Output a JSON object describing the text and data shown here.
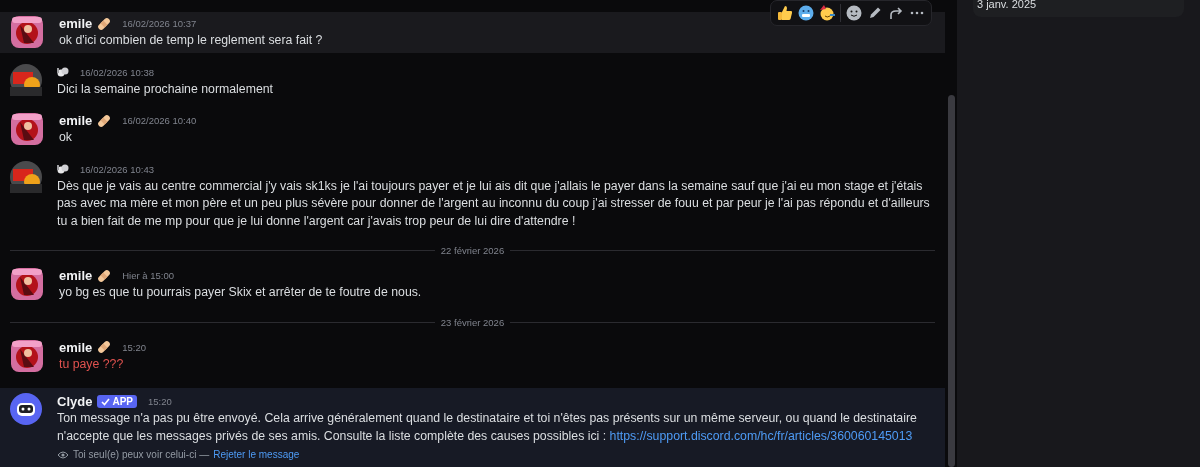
{
  "toolbar": {
    "reactions": [
      {
        "kind": "thumbs-up"
      },
      {
        "kind": "cold-face"
      },
      {
        "kind": "party-face"
      }
    ],
    "actions": [
      {
        "kind": "emoji"
      },
      {
        "kind": "edit"
      },
      {
        "kind": "forward"
      },
      {
        "kind": "more"
      }
    ]
  },
  "items": [
    {
      "kind": "message",
      "avatar": {
        "kind": "pink"
      },
      "name": "emile",
      "badge_emoji": true,
      "time": "16/02/2026 10:37",
      "text": "ok d'ici combien de temp le reglement sera fait ?",
      "hovered": true,
      "failed": false
    },
    {
      "kind": "message",
      "avatar": {
        "kind": "orange"
      },
      "time": "16/02/2026 10:38",
      "text": "Dici la semaine prochaine normalement",
      "failed": false
    },
    {
      "kind": "message",
      "avatar": {
        "kind": "pink"
      },
      "name": "emile",
      "badge_emoji": true,
      "time": "16/02/2026 10:40",
      "text": "ok",
      "failed": false
    },
    {
      "kind": "message",
      "avatar": {
        "kind": "orange"
      },
      "time": "16/02/2026 10:43",
      "text": "Dès que je vais au centre commercial j'y vais sk1ks je l'ai toujours payer et je lui ais dit que j'allais le payer dans la semaine sauf que j'ai eu mon stage et j'étais pas avec ma mère et mon père et un peu plus sévère pour donner de l'argent au inconnu du coup j'ai stresser de fouu et par peur je l'ai pas répondu et d'ailleurs tu a bien fait de me mp pour que je lui donne l'argent car j'avais trop peur de lui dire d'attendre !",
      "failed": false
    },
    {
      "kind": "divider",
      "label": "22 février 2026"
    },
    {
      "kind": "message",
      "avatar": {
        "kind": "pink"
      },
      "name": "emile",
      "badge_emoji": true,
      "time": "Hier à 15:00",
      "text": "yo bg es que tu pourrais payer Skix et arrêter de te foutre de nous.",
      "failed": false
    },
    {
      "kind": "divider",
      "label": "23 février 2026"
    },
    {
      "kind": "message",
      "avatar": {
        "kind": "pink"
      },
      "name": "emile",
      "badge_emoji": true,
      "time": "15:20",
      "text": "tu paye ???",
      "failed": true
    },
    {
      "kind": "system",
      "avatar": {
        "kind": "bot"
      },
      "name": "Clyde",
      "app_badge": "APP",
      "time": "15:20",
      "text": "Ton message n'a pas pu être envoyé. Cela arrive généralement quand le destinataire et toi n'êtes pas présents sur un même serveur, ou quand le destinataire n'accepte que les messages privés de ses amis. Consulte la liste complète des causes possibles ici : ",
      "link": "https://support.discord.com/hc/fr/articles/360060145013",
      "notice": "Toi seul(e) peux voir celui-ci —",
      "dismiss": "Rejeter le message"
    }
  ],
  "side_panel": {
    "date": "3 janv. 2025"
  }
}
